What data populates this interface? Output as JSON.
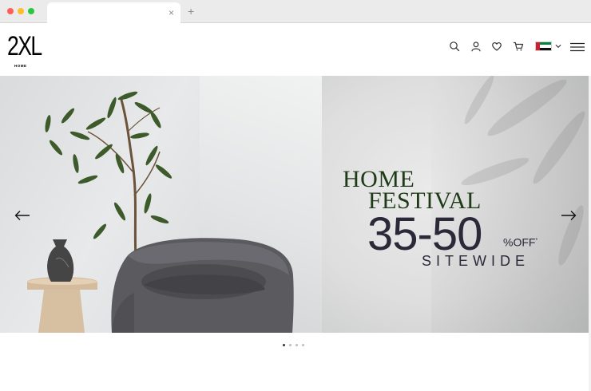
{
  "browser": {
    "tab_close": "×",
    "new_tab": "+"
  },
  "header": {
    "logo_main": "2XL",
    "logo_sub": "HOME",
    "icons": [
      "search-icon",
      "user-icon",
      "heart-icon",
      "cart-icon",
      "uae-flag-icon",
      "chevron-down-icon",
      "menu-icon"
    ]
  },
  "hero": {
    "headline_line1": "HOME",
    "headline_line2": "FESTIVAL",
    "discount": "35-50",
    "off_label": "%OFF",
    "off_mark": "*",
    "sitewide": "SITEWIDE"
  },
  "carousel": {
    "slide_count": 4,
    "active_index": 0
  },
  "colors": {
    "headline": "#1f3a16",
    "discount_text": "#2b2838",
    "flag_red": "#cf1f2e",
    "flag_green": "#00843d"
  }
}
